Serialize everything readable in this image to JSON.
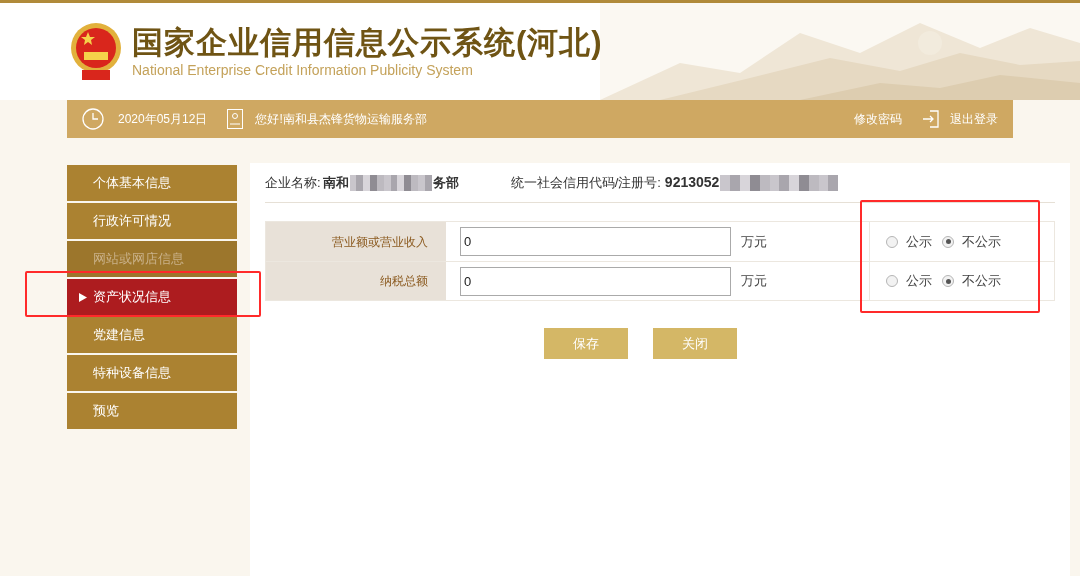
{
  "header": {
    "title": "国家企业信用信息公示系统(河北)",
    "subtitle": "National Enterprise Credit Information Publicity System"
  },
  "info_bar": {
    "date": "2020年05月12日",
    "greeting": "您好!南和县杰锋货物运输服务部",
    "links": [
      {
        "label": "修改密码",
        "kind": "plain"
      },
      {
        "label": "退出登录",
        "kind": "logout"
      }
    ]
  },
  "sidebar": {
    "items": [
      {
        "label": "个体基本信息",
        "selected": false,
        "disabled": false
      },
      {
        "label": "行政许可情况",
        "selected": false,
        "disabled": false
      },
      {
        "label": "网站或网店信息",
        "selected": false,
        "disabled": true
      },
      {
        "label": "资产状况信息",
        "selected": true,
        "disabled": false
      },
      {
        "label": "党建信息",
        "selected": false,
        "disabled": false
      },
      {
        "label": "特种设备信息",
        "selected": false,
        "disabled": false
      },
      {
        "label": "预览",
        "selected": false,
        "disabled": false
      }
    ]
  },
  "company": {
    "name_label": "企业名称:",
    "name_start": "南和",
    "name_end": "务部",
    "code_label": "统一社会信用代码/注册号:",
    "code_start": "9213052"
  },
  "rows": [
    {
      "label": "营业额或营业收入",
      "value": "0",
      "unit": "万元",
      "options": [
        {
          "label": "公示",
          "selected": false
        },
        {
          "label": "不公示",
          "selected": true
        }
      ]
    },
    {
      "label": "纳税总额",
      "value": "0",
      "unit": "万元",
      "options": [
        {
          "label": "公示",
          "selected": false
        },
        {
          "label": "不公示",
          "selected": true
        }
      ]
    }
  ],
  "buttons": [
    "保存",
    "关闭"
  ]
}
